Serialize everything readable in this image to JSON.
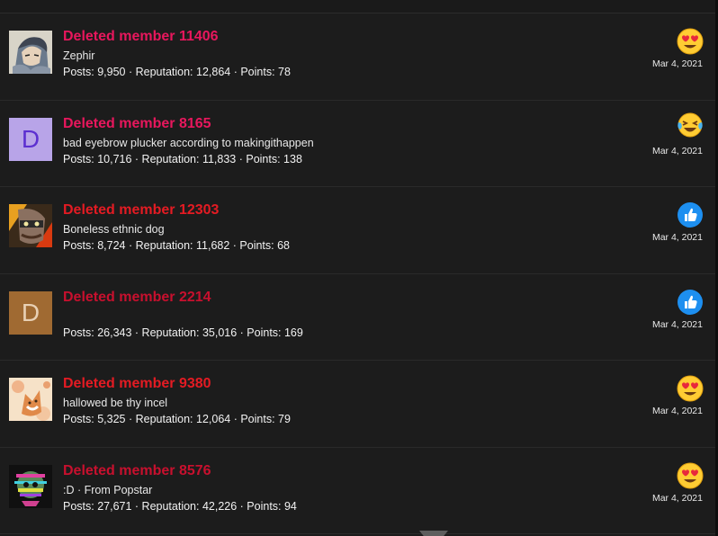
{
  "colors": {
    "background": "#1c1c1c",
    "name_pink": "#e8175d",
    "name_red": "#e41b23",
    "name_crimson": "#c8102e",
    "text": "#f2f2f2"
  },
  "members": [
    {
      "name": "Deleted member 11406",
      "name_color": "#e8175d",
      "title": "Zephir",
      "stats": "Posts: 9,950 · Reputation: 12,864 · Points: 78",
      "avatar": {
        "type": "image",
        "icon": "anime-warrior-avatar"
      },
      "reaction": "heart-eyes-emoji",
      "date": "Mar 4, 2021"
    },
    {
      "name": "Deleted member 8165",
      "name_color": "#e8175d",
      "title": "bad eyebrow plucker according to makingithappen",
      "stats": "Posts: 10,716 · Reputation: 11,833 · Points: 138",
      "avatar": {
        "type": "letter",
        "letter": "D",
        "bg": "#b8a4e8",
        "fg": "#5c2fd0"
      },
      "reaction": "crying-laughing-emoji",
      "date": "Mar 4, 2021"
    },
    {
      "name": "Deleted member 12303",
      "name_color": "#e41b23",
      "title": "Boneless ethnic dog",
      "stats": "Posts: 8,724 · Reputation: 11,682 · Points: 68",
      "avatar": {
        "type": "image",
        "icon": "masked-character-avatar"
      },
      "reaction": "thumbs-up-icon",
      "date": "Mar 4, 2021"
    },
    {
      "name": "Deleted member 2214",
      "name_color": "#c8102e",
      "title": "",
      "stats": "Posts: 26,343 · Reputation: 35,016 · Points: 169",
      "avatar": {
        "type": "letter",
        "letter": "D",
        "bg": "#a06a32",
        "fg": "#e8d0b4"
      },
      "reaction": "thumbs-up-icon",
      "date": "Mar 4, 2021"
    },
    {
      "name": "Deleted member 9380",
      "name_color": "#e41b23",
      "title": "hallowed be thy incel",
      "stats": "Posts: 5,325 · Reputation: 12,064 · Points: 79",
      "avatar": {
        "type": "image",
        "icon": "fox-illustration-avatar"
      },
      "reaction": "heart-eyes-emoji",
      "date": "Mar 4, 2021"
    },
    {
      "name": "Deleted member 8576",
      "name_color": "#c8102e",
      "title": ":D · From Popstar",
      "stats": "Posts: 27,671 · Reputation: 42,226 · Points: 94",
      "avatar": {
        "type": "image",
        "icon": "glitch-art-avatar"
      },
      "reaction": "heart-eyes-emoji",
      "date": "Mar 4, 2021"
    }
  ]
}
